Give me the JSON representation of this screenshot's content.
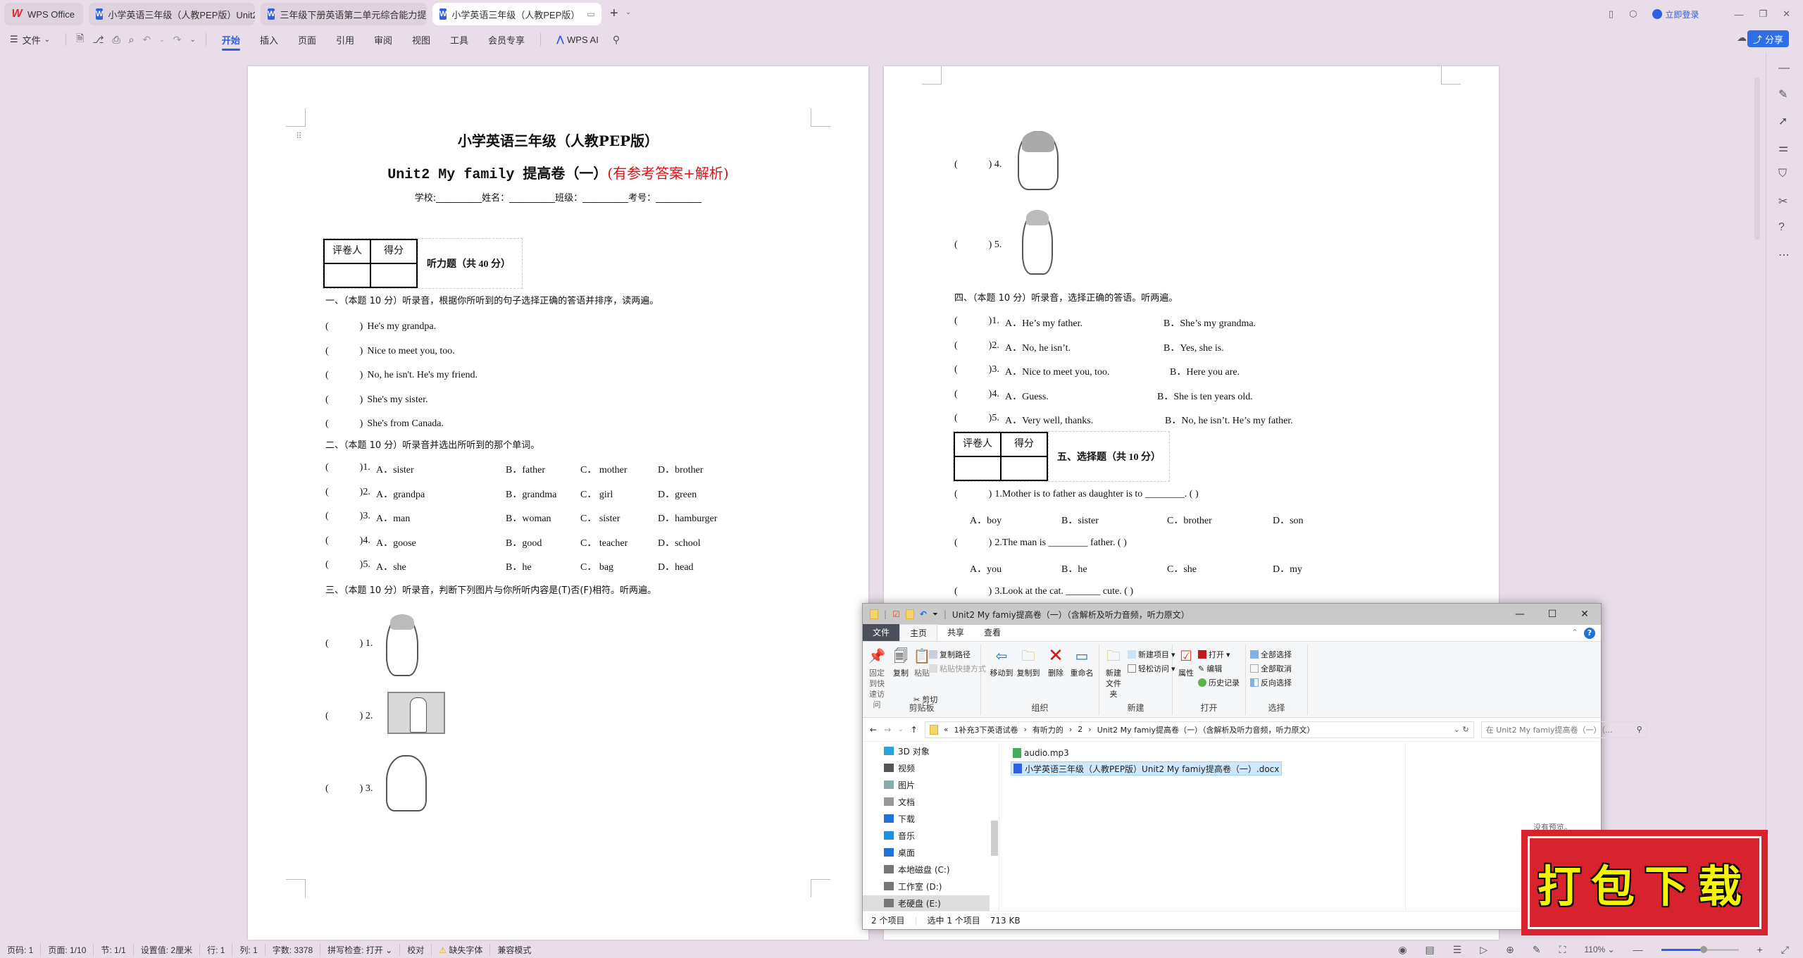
{
  "tabs": [
    {
      "label": "WPS Office",
      "icon": "wps-logo-icon",
      "state": "inactive"
    },
    {
      "label": "小学英语三年级（人教PEP版）Unit2",
      "icon": "word-doc-icon",
      "state": "inactive"
    },
    {
      "label": "三年级下册英语第二单元综合能力提",
      "icon": "word-doc-icon",
      "state": "inactive"
    },
    {
      "label": "小学英语三年级（人教PEP版）",
      "icon": "word-doc-icon",
      "state": "active"
    }
  ],
  "window": {
    "login_label": "立即登录"
  },
  "toolbar": {
    "file_menu": "文件",
    "menus": [
      "开始",
      "插入",
      "页面",
      "引用",
      "审阅",
      "视图",
      "工具",
      "会员专享"
    ],
    "selected_menu": "开始",
    "wps_ai": "WPS AI",
    "share": "分享"
  },
  "page1": {
    "title": "小学英语三年级（人教PEP版）",
    "subtitle_main": "Unit2 My family 提高卷（一）",
    "subtitle_red": "(有参考答案+解析)",
    "info_line": "学校:__________姓名：__________班级：__________考号：__________",
    "score_table": {
      "grader": "评卷人",
      "score": "得分",
      "section": "听力题（共 40 分）"
    },
    "sec1": {
      "heading": "一、（本题 10 分）听录音，根据你所听到的句子选择正确的答语并排序，读两遍。",
      "items": [
        "He's my grandpa.",
        "Nice to meet you, too.",
        "No, he isn't. He's my friend.",
        "She's my sister.",
        "She's from Canada."
      ]
    },
    "sec2": {
      "heading": "二、（本题 10 分）听录音并选出所听到的那个单词。",
      "items": [
        {
          "n": "1.",
          "a": "A．sister",
          "b": "B．father",
          "c": "C．  mother",
          "d": "D．brother"
        },
        {
          "n": "2.",
          "a": "A．grandpa",
          "b": "B．grandma",
          "c": "C．  girl",
          "d": "D．green"
        },
        {
          "n": "3.",
          "a": "A．man",
          "b": "B．woman",
          "c": "C．  sister",
          "d": "D．hamburger"
        },
        {
          "n": "4.",
          "a": "A．goose",
          "b": "B．good",
          "c": "C．  teacher",
          "d": "D．school"
        },
        {
          "n": "5.",
          "a": "A．she",
          "b": "B．he",
          "c": "C．  bag",
          "d": "D．head"
        }
      ]
    },
    "sec3": {
      "heading": "三、（本题 10 分）听录音，判断下列图片与你所听内容是(T)否(F)相符。听两遍。",
      "items": [
        "1.",
        "2.",
        "3."
      ]
    }
  },
  "page2": {
    "sec3_cont": [
      "4.",
      "5."
    ],
    "sec4": {
      "heading": "四、（本题 10 分）听录音，选择正确的答语。听两遍。",
      "items": [
        {
          "n": "1.",
          "a": "A．He’s my father.",
          "b": "B．She’s my grandma."
        },
        {
          "n": "2.",
          "a": "A．No, he isn’t.",
          "b": "B．Yes, she is."
        },
        {
          "n": "3.",
          "a": "A．Nice to meet you, too.",
          "b": "B．Here you are."
        },
        {
          "n": "4.",
          "a": "A．Guess.",
          "b": "B．She is ten years old."
        },
        {
          "n": "5.",
          "a": "A．Very well, thanks.",
          "b": "B．No, he isn’t. He’s my father."
        }
      ]
    },
    "score_table": {
      "grader": "评卷人",
      "score": "得分",
      "section": "五、选择题（共 10 分）"
    },
    "sec5": {
      "items": [
        {
          "q": "1.Mother is to father as daughter is to ________. (    )",
          "a": "A．boy",
          "b": "B．sister",
          "c": "C．brother",
          "d": "D．son"
        },
        {
          "q": "2.The man is ________ father. (    )",
          "a": "A．you",
          "b": "B．he",
          "c": "C．she",
          "d": "D．my"
        },
        {
          "q": "3.Look at the cat. _______ cute. (    )"
        }
      ]
    }
  },
  "explorer": {
    "title": "Unit2 My famiy提高卷（一）（含解析及听力音频，听力原文）",
    "tabs": [
      "文件",
      "主页",
      "共享",
      "查看"
    ],
    "active_tab": "主页",
    "ribbon": {
      "clipboard": {
        "label": "剪贴板",
        "pin": "固定到快速访问",
        "copy": "复制",
        "paste": "粘贴",
        "copy_path": "复制路径",
        "paste_shortcut": "粘贴快捷方式",
        "cut": "剪切"
      },
      "organize": {
        "label": "组织",
        "move_to": "移动到",
        "copy_to": "复制到",
        "delete": "删除",
        "rename": "重命名"
      },
      "new": {
        "label": "新建",
        "new_folder": "新建\n文件夹",
        "new_item": "新建项目",
        "easy_access": "轻松访问"
      },
      "open": {
        "label": "打开",
        "properties": "属性",
        "open": "打开",
        "edit": "编辑",
        "history": "历史记录"
      },
      "select": {
        "label": "选择",
        "select_all": "全部选择",
        "select_none": "全部取消",
        "invert": "反向选择"
      }
    },
    "breadcrumb": [
      "1补充3下英语试卷",
      "有听力的",
      "2",
      "Unit2 My famiy提高卷（一）（含解析及听力音频，听力原文）"
    ],
    "search_placeholder": "在 Unit2 My famiy提高卷（一）（...",
    "nav": [
      "3D 对象",
      "视频",
      "图片",
      "文档",
      "下载",
      "音乐",
      "桌面",
      "本地磁盘 (C:)",
      "工作室 (D:)",
      "老硬盘 (E:)"
    ],
    "nav_selected": "老硬盘 (E:)",
    "files": [
      {
        "name": "audio.mp3",
        "type": "audio",
        "selected": false
      },
      {
        "name": "小学英语三年级（人教PEP版）Unit2 My famiy提高卷（一）.docx",
        "type": "docx",
        "selected": true
      }
    ],
    "preview_text": "没有预览。",
    "status": {
      "count": "2 个项目",
      "selected": "选中 1 个项目",
      "size": "713 KB"
    }
  },
  "stamp": {
    "text": "打包下载",
    "bg_color": "#d8232e",
    "text_color": "#f4f400"
  },
  "statusbar": {
    "items": [
      "页码: 1",
      "页面: 1/10",
      "节: 1/1",
      "设置值: 2厘米",
      "行: 1",
      "列: 1",
      "字数: 3378",
      "拼写检查: 打开",
      "校对",
      "缺失字体",
      "兼容模式"
    ],
    "zoom": "110%",
    "zoom_fraction": 0.55
  },
  "colors": {
    "accent": "#2f5fe3",
    "title_red": "#e01010",
    "background": "#e8dde9"
  }
}
